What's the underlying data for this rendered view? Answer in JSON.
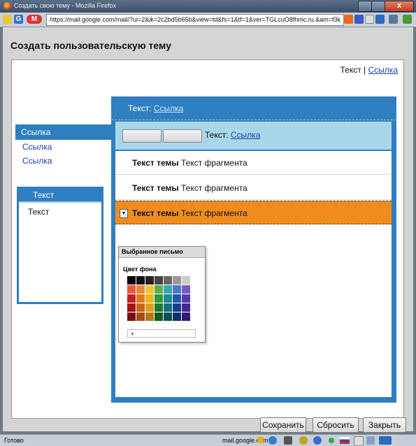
{
  "window": {
    "title": "Создать свою тему - Mozilla Firefox",
    "close_label": "x"
  },
  "urlbar": {
    "url": "https://mail.google.com/mail/?ui=2&ik=2c2bd5b65b&view=td&fs=1&tf=1&ver=TGLcuO8fhmc.ru.&am=f3k"
  },
  "dialog": {
    "title": "Создать пользовательскую тему",
    "top_text": "Текст",
    "top_separator": "|",
    "top_link": "Ссылка"
  },
  "nav": {
    "selected": "Ссылка",
    "links": [
      "Ссылка",
      "Ссылка"
    ],
    "box_head": "Текст",
    "box_body": "Текст"
  },
  "main": {
    "head_text": "Текст:",
    "head_link": "Ссылка",
    "toolbar_text": "Текст:",
    "toolbar_link": "Ссылка",
    "rows": [
      {
        "bold": "Текст темы",
        "text": "Текст фрагмента"
      },
      {
        "bold": "Текст темы",
        "text": "Текст фрагмента"
      },
      {
        "bold": "Текст темы",
        "text": "Текст фрагмента"
      }
    ]
  },
  "popup": {
    "title": "Выбранное письмо",
    "subtitle": "Цвет фона",
    "colors": [
      "#000000",
      "#111111",
      "#222222",
      "#444444",
      "#666666",
      "#999999",
      "#cccccc",
      "#e35b3a",
      "#e38a3a",
      "#f0c53a",
      "#5cb04a",
      "#3aa6b0",
      "#4a7ac8",
      "#7a5ac8",
      "#c81e1e",
      "#e0781e",
      "#f2b51e",
      "#2e9a3a",
      "#1e8a9a",
      "#1e5ab0",
      "#5a3ab0",
      "#a01414",
      "#c8641e",
      "#e0a01e",
      "#1e7a2a",
      "#16707a",
      "#183e90",
      "#442890",
      "#781010",
      "#a04c14",
      "#b87a14",
      "#145a1e",
      "#0e5058",
      "#10306a",
      "#301c6a"
    ],
    "foot": "+"
  },
  "buttons": {
    "save": "Сохранить",
    "reset": "Сбросить",
    "close": "Закрыть"
  },
  "status": {
    "left": "Готово",
    "domain": "mail.google.com"
  }
}
